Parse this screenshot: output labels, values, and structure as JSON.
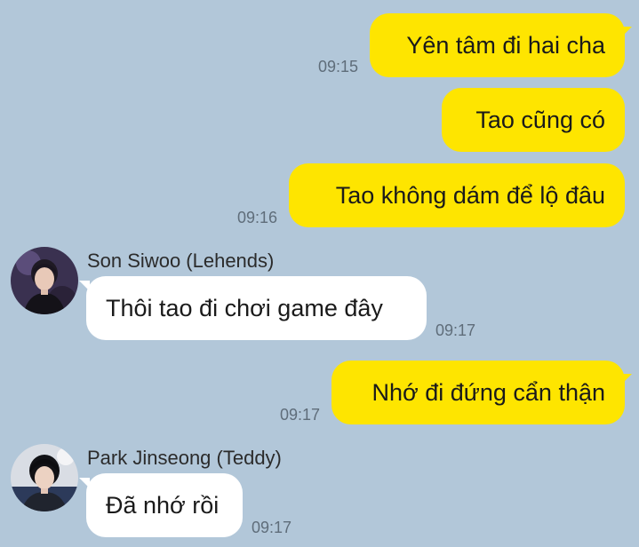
{
  "messages": [
    {
      "type": "outgoing",
      "text": "Yên tâm đi hai cha",
      "time": "09:15"
    },
    {
      "type": "outgoing",
      "text": "Tao cũng có",
      "time": ""
    },
    {
      "type": "outgoing",
      "text": "Tao không dám để lộ đâu",
      "time": "09:16"
    },
    {
      "type": "incoming",
      "sender": "Son Siwoo (Lehends)",
      "avatar_icon": "profile-photo-icon",
      "text": "Thôi tao đi chơi game đây",
      "time": "09:17"
    },
    {
      "type": "outgoing",
      "text": "Nhớ đi đứng cẩn thận",
      "time": "09:17"
    },
    {
      "type": "incoming",
      "sender": "Park Jinseong (Teddy)",
      "avatar_icon": "profile-photo-icon",
      "text": "Đã nhớ rồi",
      "time": "09:17"
    }
  ],
  "colors": {
    "background": "#b2c7d9",
    "outgoing_bubble": "#fee500",
    "incoming_bubble": "#ffffff",
    "timestamp": "#5f6d7a"
  }
}
